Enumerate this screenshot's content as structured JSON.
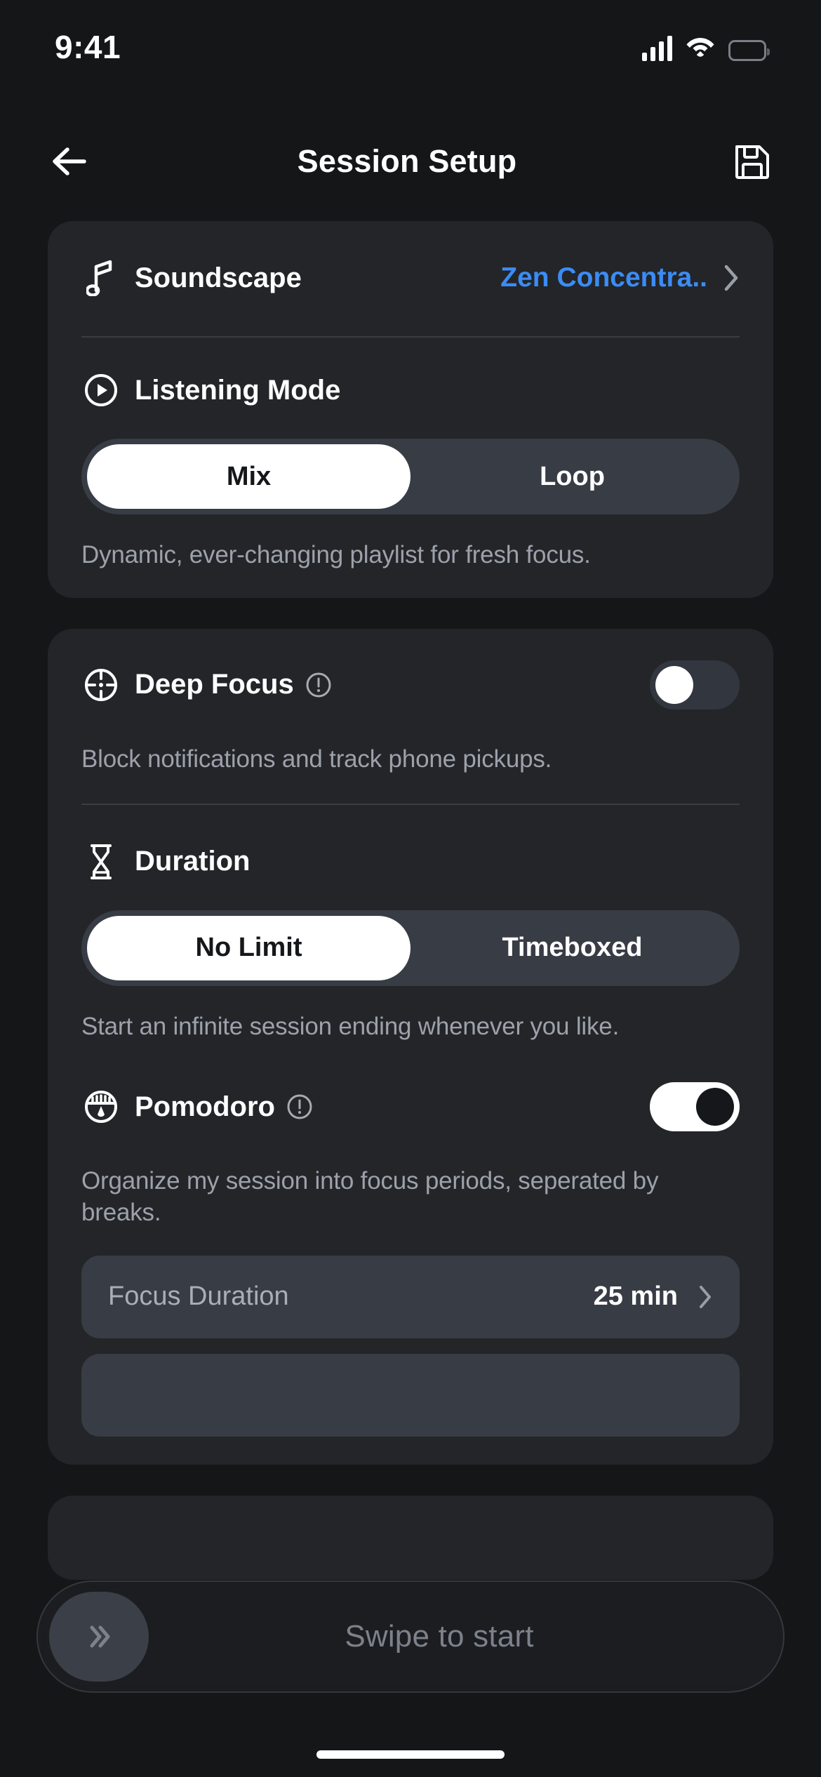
{
  "status_bar": {
    "time": "9:41",
    "cellular_icon": "cellular-signal-icon",
    "wifi_icon": "wifi-icon",
    "battery_icon": "battery-icon"
  },
  "nav": {
    "back_icon": "back-arrow-icon",
    "title": "Session Setup",
    "save_icon": "save-floppy-icon"
  },
  "audio_card": {
    "soundscape": {
      "icon": "music-note-icon",
      "label": "Soundscape",
      "value": "Zen Concentra..",
      "chevron_icon": "chevron-right-icon"
    },
    "listening_mode": {
      "icon": "play-circle-icon",
      "label": "Listening Mode",
      "options": [
        "Mix",
        "Loop"
      ],
      "selected": "Mix",
      "caption": "Dynamic, ever-changing playlist for fresh focus."
    }
  },
  "focus_card": {
    "deep_focus": {
      "icon": "crosshair-target-icon",
      "label": "Deep Focus",
      "info_icon": "info-exclamation-icon",
      "toggle_state": "off",
      "caption": "Block notifications  and track phone pickups."
    },
    "duration": {
      "icon": "hourglass-icon",
      "label": "Duration",
      "options": [
        "No Limit",
        "Timeboxed"
      ],
      "selected": "No Limit",
      "caption": "Start an infinite session ending whenever you like."
    },
    "pomodoro": {
      "icon": "pomodoro-timer-icon",
      "label": "Pomodoro",
      "info_icon": "info-exclamation-icon",
      "toggle_state": "on",
      "caption": "Organize my session into focus periods, seperated by breaks.",
      "focus_duration": {
        "label": "Focus Duration",
        "value": "25 min",
        "chevron_icon": "chevron-right-icon"
      }
    }
  },
  "swipe_action": {
    "knob_icon": "double-chevron-right-icon",
    "label": "Swipe to start"
  },
  "colors": {
    "page_background": "#151618",
    "card_background": "#232528",
    "accent_blue": "#3b8cf5",
    "muted_text": "#9ca1ab",
    "control_track": "#383c45"
  }
}
